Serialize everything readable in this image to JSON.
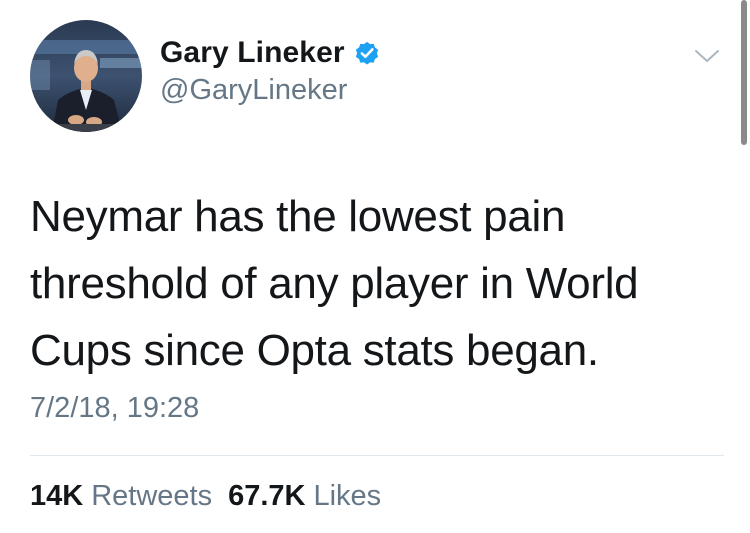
{
  "user": {
    "display_name": "Gary Lineker",
    "handle": "@GaryLineker",
    "verified": true,
    "avatar_icon": "profile-photo-avatar"
  },
  "tweet": {
    "text": "Neymar has the lowest pain threshold of any player in World Cups since Opta stats began.",
    "timestamp": "7/2/18, 19:28"
  },
  "stats": {
    "retweets_count": "14K",
    "retweets_label": "Retweets",
    "likes_count": "67.7K",
    "likes_label": "Likes"
  },
  "colors": {
    "text_primary": "#14171a",
    "text_secondary": "#657786",
    "verified_blue": "#1da1f2",
    "divider": "#e1e8ed"
  },
  "icons": {
    "verified": "verified-badge-icon",
    "menu": "chevron-down-icon"
  }
}
